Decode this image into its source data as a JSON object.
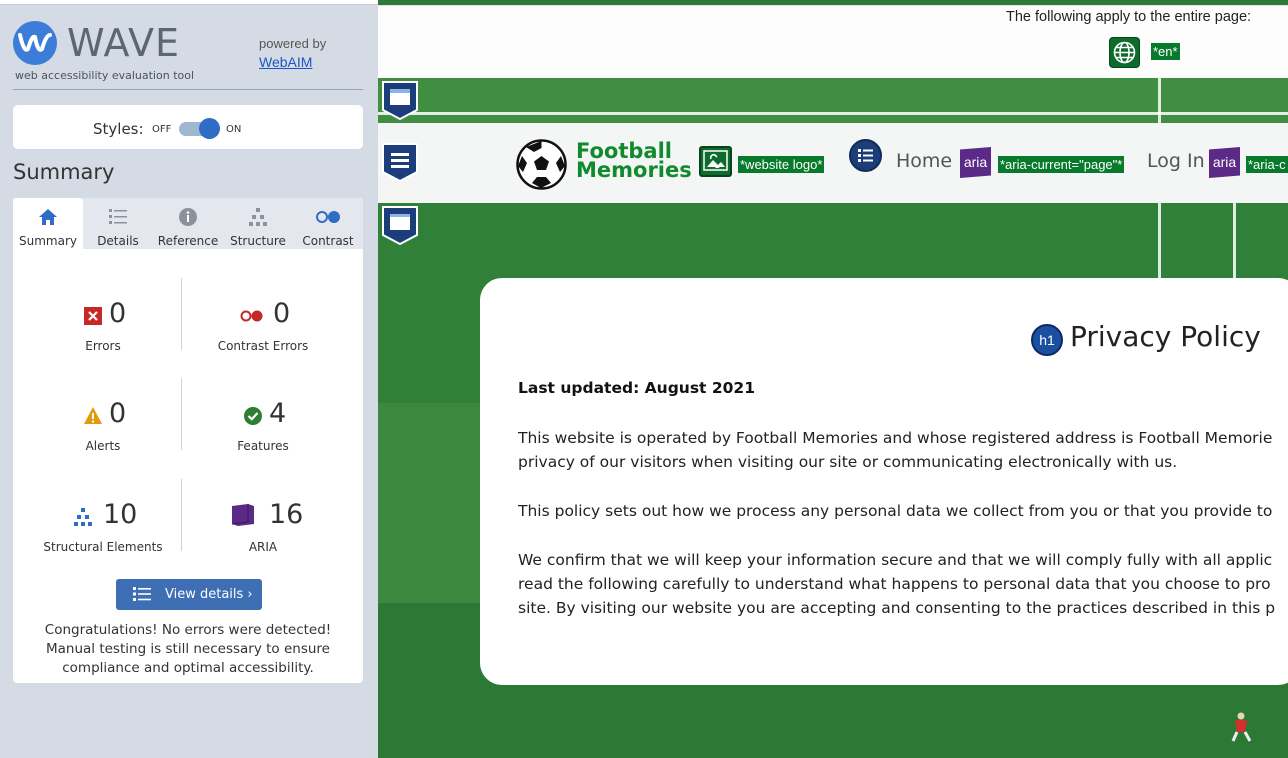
{
  "sidebar": {
    "brand": "WAVE",
    "subtitle": "web accessibility evaluation tool",
    "powered_by": "powered by",
    "webaim_link": "WebAIM",
    "styles_label": "Styles:",
    "styles_off": "OFF",
    "styles_on": "ON",
    "styles_enabled": true,
    "summary_heading": "Summary",
    "tabs": [
      {
        "label": "Summary",
        "icon": "home-icon",
        "active": true
      },
      {
        "label": "Details",
        "icon": "list-icon",
        "active": false
      },
      {
        "label": "Reference",
        "icon": "info-icon",
        "active": false
      },
      {
        "label": "Structure",
        "icon": "structure-icon",
        "active": false
      },
      {
        "label": "Contrast",
        "icon": "contrast-icon",
        "active": false
      }
    ],
    "stats": {
      "errors": {
        "count": "0",
        "label": "Errors"
      },
      "contrast_errors": {
        "count": "0",
        "label": "Contrast Errors"
      },
      "alerts": {
        "count": "0",
        "label": "Alerts"
      },
      "features": {
        "count": "4",
        "label": "Features"
      },
      "structural": {
        "count": "10",
        "label": "Structural Elements"
      },
      "aria": {
        "count": "16",
        "label": "ARIA"
      }
    },
    "view_details_button": "View details ›",
    "congrats": "Congratulations! No errors were detected! Manual testing is still necessary to ensure compliance and optimal accessibility."
  },
  "page": {
    "apply_text": "The following apply to the entire page:",
    "lang_tag": "*en*",
    "logo_alt_tag": "*website logo*",
    "logo_line1": "Football",
    "logo_line2": "Memories",
    "nav": [
      {
        "label": "Home",
        "aria_tag": "*aria-current=\"page\"*"
      },
      {
        "label": "Log In",
        "aria_tag": "*aria-c"
      }
    ],
    "aria_badge": "aria",
    "h1_badge": "h1",
    "title": "Privacy Policy",
    "updated": "Last updated: August 2021",
    "p1_line1": "This website is operated by Football Memories and whose registered address is Football Memorie",
    "p1_line2": "privacy of our visitors when visiting our site or communicating electronically with us.",
    "p2_line1": "This policy sets out how we process any personal data we collect from you or that you provide to",
    "p3_line1": "We confirm that we will keep your information secure and that we will comply fully with all applic",
    "p3_line2": "read the following carefully to understand what happens to personal data that you choose to pro",
    "p3_line3": "site. By visiting our website you are accepting and consenting to the practices described in this p"
  },
  "colors": {
    "sidebar_bg": "#d5dbe4",
    "accent_blue": "#3e6fb5",
    "error_red": "#c62828",
    "alert_orange": "#e39a0c",
    "feature_green": "#2e7d32",
    "aria_purple": "#5b2a86",
    "wave_tag_green": "#087a2b"
  }
}
